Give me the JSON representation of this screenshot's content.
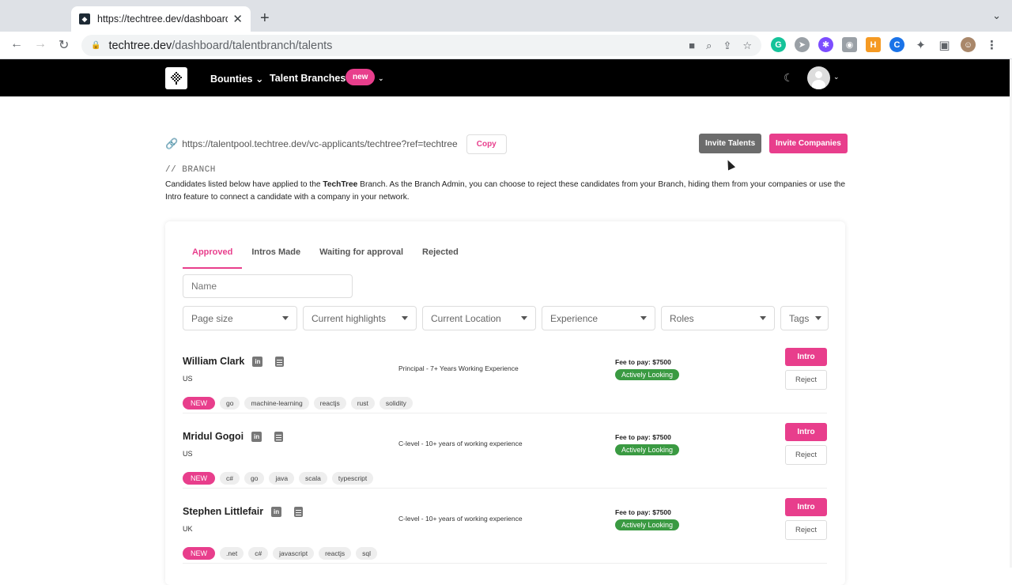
{
  "browser": {
    "tab_title": "https://techtree.dev/dashboard",
    "url_host": "techtree.dev",
    "url_path": "/dashboard/talentbranch/talents"
  },
  "header": {
    "nav": [
      {
        "label": "Bounties"
      },
      {
        "label": "Talent Branches"
      }
    ],
    "new_badge": "new"
  },
  "invite": {
    "link": "https://talentpool.techtree.dev/vc-applicants/techtree?ref=techtree",
    "copy_label": "Copy",
    "invite_talents": "Invite Talents",
    "invite_companies": "Invite Companies"
  },
  "branch": {
    "label": "// BRANCH",
    "desc_prefix": "Candidates listed below have applied to the ",
    "desc_bold": "TechTree",
    "desc_suffix": " Branch. As the Branch Admin, you can choose to reject these candidates from your Branch, hiding them from your companies or use the Intro feature to connect a candidate with a company in your network."
  },
  "tabs": [
    {
      "label": "Approved",
      "active": true
    },
    {
      "label": "Intros Made"
    },
    {
      "label": "Waiting for approval"
    },
    {
      "label": "Rejected"
    }
  ],
  "search": {
    "placeholder": "Name"
  },
  "filters": [
    {
      "label": "Page size"
    },
    {
      "label": "Current highlights"
    },
    {
      "label": "Current Location"
    },
    {
      "label": "Experience"
    },
    {
      "label": "Roles"
    },
    {
      "label": "Tags"
    }
  ],
  "candidates": [
    {
      "name": "William Clark",
      "country": "US",
      "experience": "Principal - 7+ Years Working Experience",
      "fee": "Fee to pay: $7500",
      "status": "Actively Looking",
      "new_label": "NEW",
      "tags": [
        "go",
        "machine-learning",
        "reactjs",
        "rust",
        "solidity"
      ]
    },
    {
      "name": "Mridul Gogoi",
      "country": "US",
      "experience": "C-level - 10+ years of working experience",
      "fee": "Fee to pay: $7500",
      "status": "Actively Looking",
      "new_label": "NEW",
      "tags": [
        "c#",
        "go",
        "java",
        "scala",
        "typescript"
      ]
    },
    {
      "name": "Stephen Littlefair",
      "country": "UK",
      "experience": "C-level - 10+ years of working experience",
      "fee": "Fee to pay: $7500",
      "status": "Actively Looking",
      "new_label": "NEW",
      "tags": [
        ".net",
        "c#",
        "javascript",
        "reactjs",
        "sql"
      ]
    }
  ],
  "actions": {
    "intro": "Intro",
    "reject": "Reject"
  },
  "colors": {
    "accent": "#e83e8c",
    "status_green": "#3a9a42",
    "header_bg": "#000000"
  }
}
